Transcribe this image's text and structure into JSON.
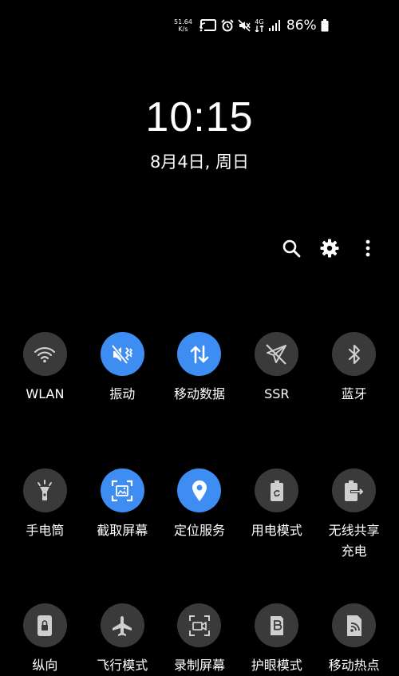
{
  "status_bar": {
    "speed_value": "51.64",
    "speed_unit": "K/s",
    "network": "4G",
    "battery": "86%",
    "icons": [
      "cast-icon",
      "alarm-icon",
      "mute-icon",
      "data-arrows-icon",
      "signal-icon",
      "battery-icon"
    ]
  },
  "clock": {
    "time": "10:15",
    "date": "8月4日, 周日"
  },
  "actions": [
    "search-icon",
    "gear-icon",
    "more-vertical-icon"
  ],
  "colors": {
    "tile_on": "#3e8df3",
    "tile_off": "#3a3a3a",
    "background": "#000000"
  },
  "tiles": {
    "wlan": {
      "label": "WLAN",
      "icon": "wifi-icon",
      "active": false
    },
    "vibrate": {
      "label": "振动",
      "icon": "vibrate-icon",
      "active": true
    },
    "mobile_data": {
      "label": "移动数据",
      "icon": "data-arrows-icon",
      "active": true
    },
    "ssr": {
      "label": "SSR",
      "icon": "paper-plane-off-icon",
      "active": false
    },
    "bluetooth": {
      "label": "蓝牙",
      "icon": "bluetooth-icon",
      "active": false
    },
    "flashlight": {
      "label": "手电筒",
      "icon": "flashlight-icon",
      "active": false
    },
    "screenshot": {
      "label": "截取屏幕",
      "icon": "screenshot-icon",
      "active": true
    },
    "location": {
      "label": "定位服务",
      "icon": "location-icon",
      "active": true
    },
    "power_mode": {
      "label": "用电模式",
      "icon": "battery-recycle-icon",
      "active": false
    },
    "wireless_share": {
      "label": "无线共享\n充电",
      "icon": "wireless-powershare-icon",
      "active": false
    },
    "portrait": {
      "label": "纵向",
      "icon": "rotation-lock-icon",
      "active": false
    },
    "airplane": {
      "label": "飞行模式",
      "icon": "airplane-icon",
      "active": false
    },
    "screen_record": {
      "label": "录制屏幕",
      "icon": "screen-record-icon",
      "active": false
    },
    "eye_comfort": {
      "label": "护眼模式",
      "icon": "eye-comfort-icon",
      "active": false
    },
    "hotspot": {
      "label": "移动热点",
      "icon": "hotspot-icon",
      "active": false
    }
  }
}
